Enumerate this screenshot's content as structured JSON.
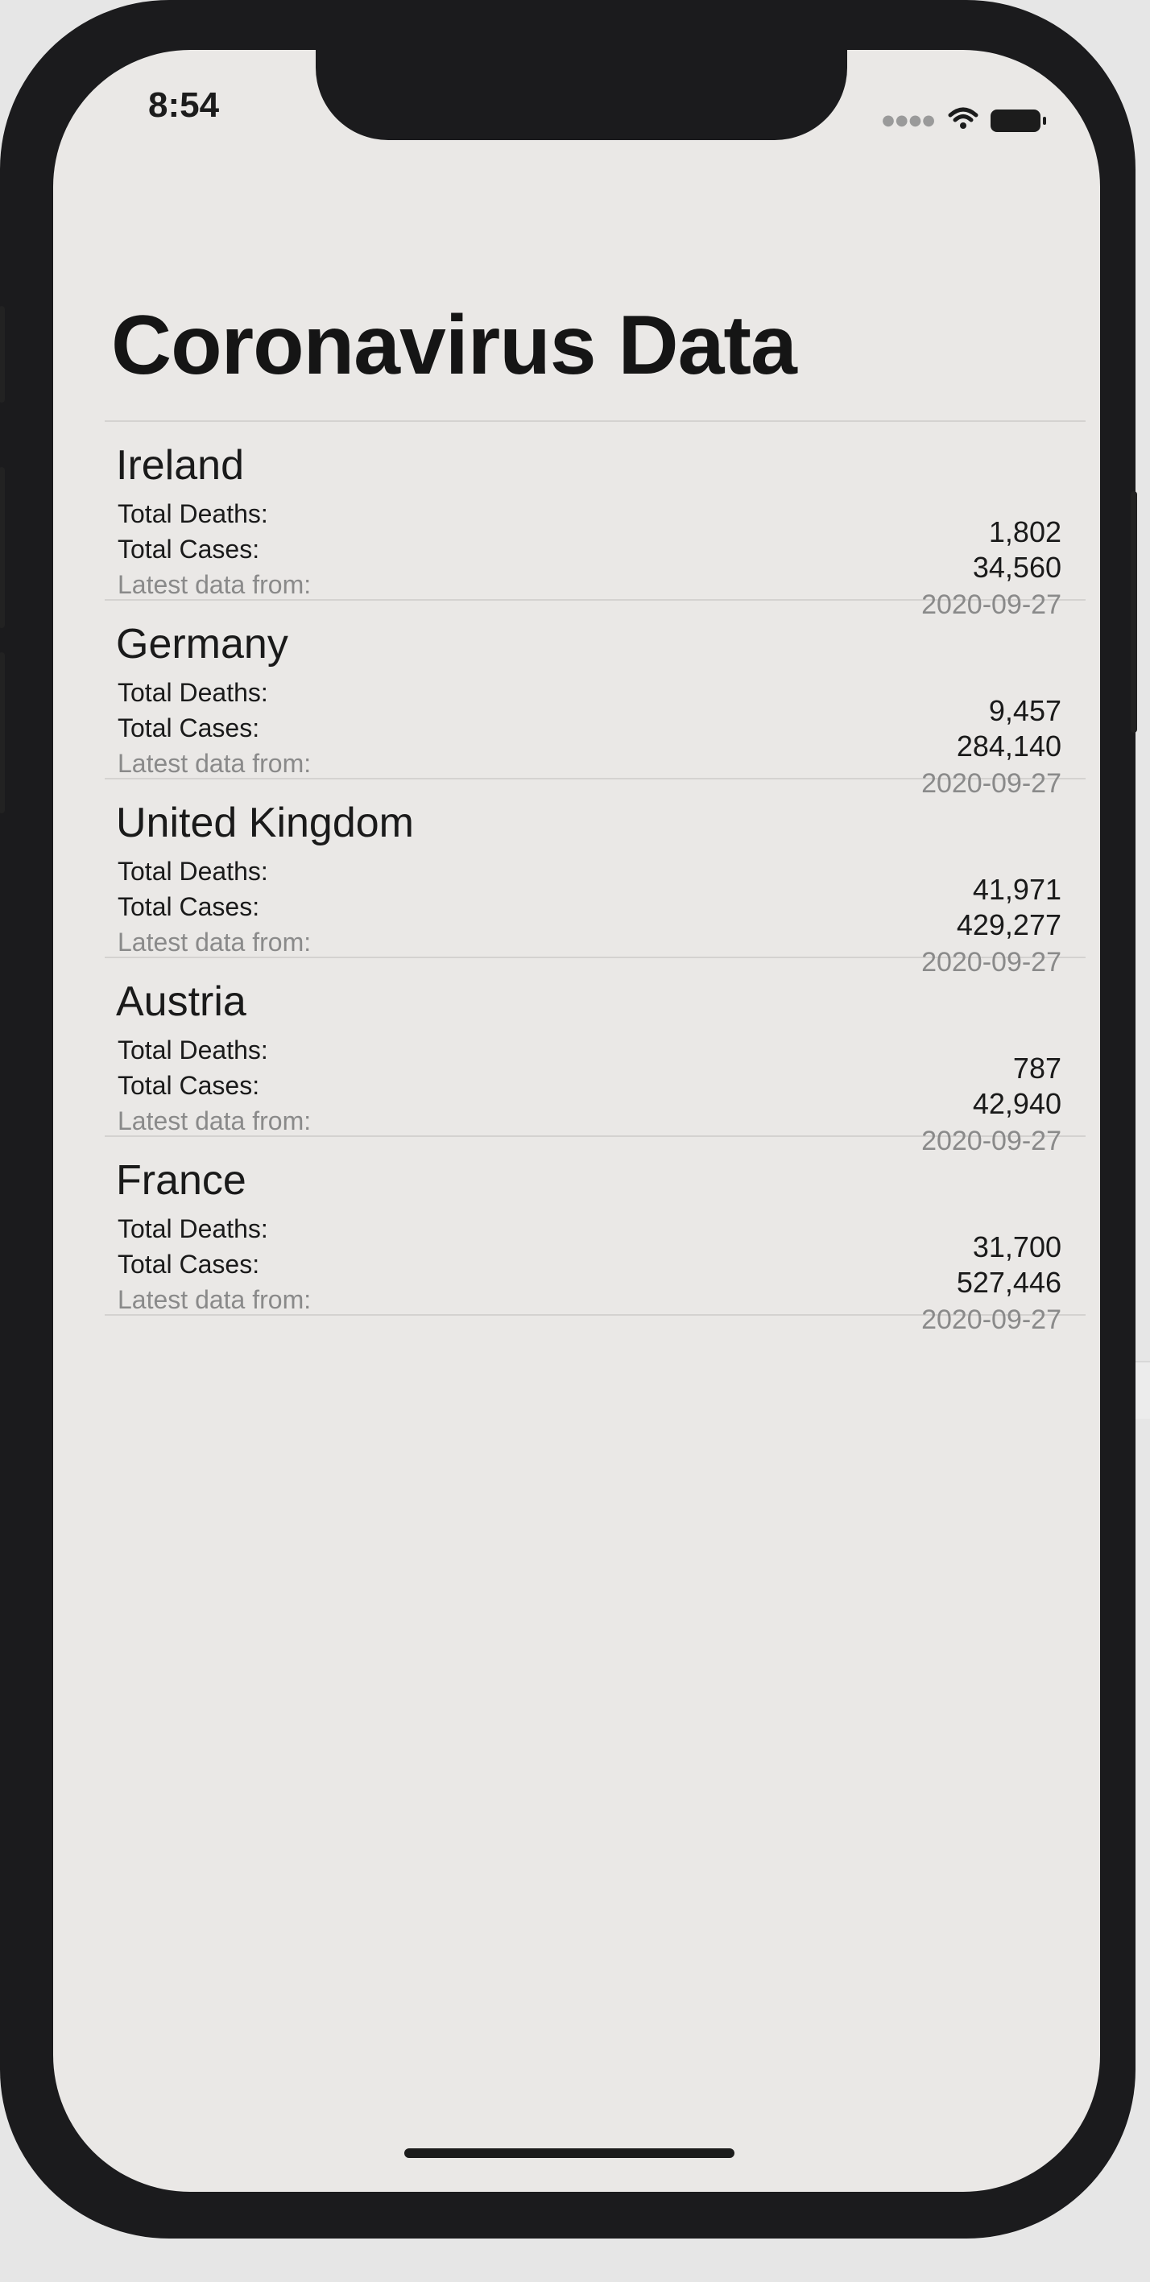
{
  "status_bar": {
    "time": "8:54"
  },
  "header": {
    "title": "Coronavirus Data"
  },
  "labels": {
    "total_deaths": "Total Deaths:",
    "total_cases": "Total Cases:",
    "latest_data": "Latest data from:"
  },
  "countries": [
    {
      "name": "Ireland",
      "deaths": "1,802",
      "cases": "34,560",
      "date": "2020-09-27"
    },
    {
      "name": "Germany",
      "deaths": "9,457",
      "cases": "284,140",
      "date": "2020-09-27"
    },
    {
      "name": "United Kingdom",
      "deaths": "41,971",
      "cases": "429,277",
      "date": "2020-09-27"
    },
    {
      "name": "Austria",
      "deaths": "787",
      "cases": "42,940",
      "date": "2020-09-27"
    },
    {
      "name": "France",
      "deaths": "31,700",
      "cases": "527,446",
      "date": "2020-09-27"
    }
  ],
  "background": {
    "code_fragment": "lu"
  },
  "icons": {
    "wifi": "wifi-icon",
    "battery": "battery-icon",
    "signal": "cellular-signal-icon"
  },
  "colors": {
    "screen_bg": "#eae8e6",
    "primary_text": "#1a1a1a",
    "secondary_text": "#8a8a8a",
    "separator": "#d4d2d0",
    "device_frame": "#1b1b1d"
  }
}
